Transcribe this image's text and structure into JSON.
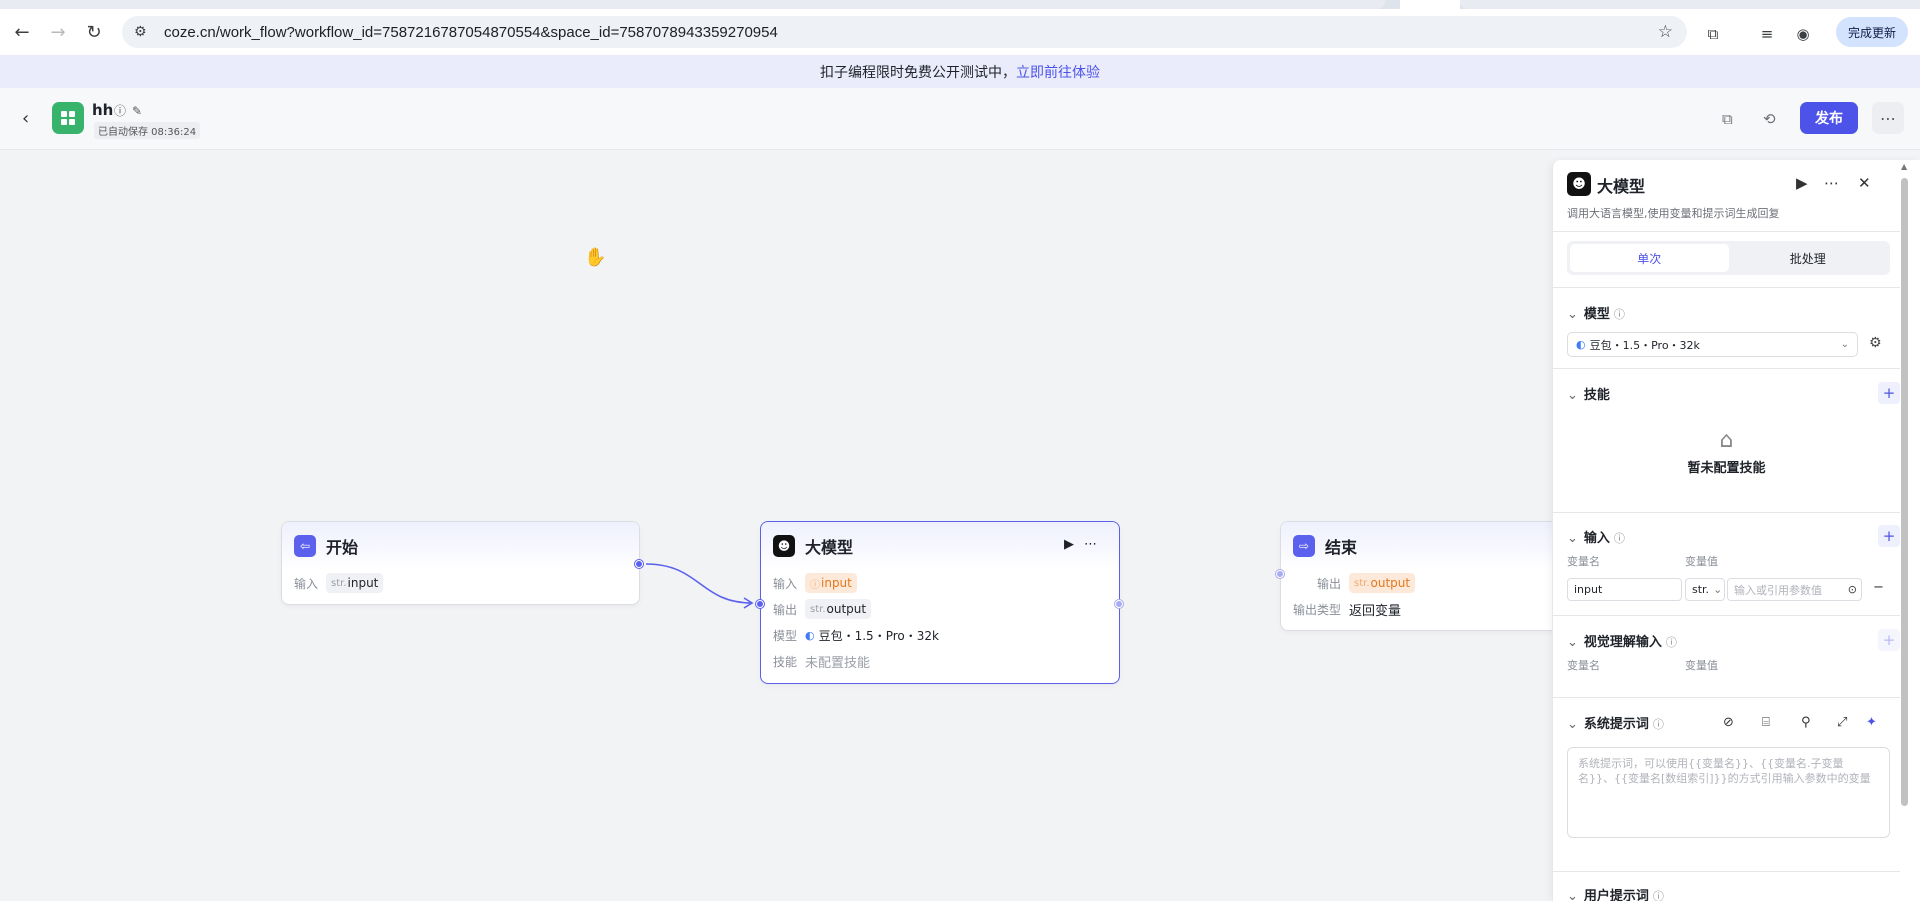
{
  "browser": {
    "url": "coze.cn/work_flow?workflow_id=7587216787054870554&space_id=7587078943359270954",
    "update_label": "完成更新"
  },
  "banner": {
    "text": "扣子编程限时免费公开测试中，",
    "link": "立即前往体验"
  },
  "header": {
    "workflow_name": "hh",
    "autosave": "已自动保存 08:36:24",
    "publish_label": "发布"
  },
  "nodes": {
    "start": {
      "title": "开始",
      "input_label": "输入",
      "input_type": "str.",
      "input_name": "input"
    },
    "llm": {
      "title": "大模型",
      "input_label": "输入",
      "input_name": "input",
      "output_label": "输出",
      "output_type": "str.",
      "output_name": "output",
      "model_label": "模型",
      "model_value": "豆包・1.5・Pro・32k",
      "skill_label": "技能",
      "skill_value": "未配置技能"
    },
    "end": {
      "title": "结束",
      "output_label": "输出",
      "output_type": "str.",
      "output_name": "output",
      "output_type_label": "输出类型",
      "output_type_value": "返回变量"
    }
  },
  "panel": {
    "title": "大模型",
    "description": "调用大语言模型,使用变量和提示词生成回复",
    "tabs": [
      "单次",
      "批处理"
    ],
    "active_tab": "单次",
    "model_section": "模型",
    "model_value": "豆包・1.5・Pro・32k",
    "skill_section": "技能",
    "skill_empty": "暂未配置技能",
    "input_section": "输入",
    "var_name_label": "变量名",
    "var_value_label": "变量值",
    "input_var_name": "input",
    "input_var_type": "str.",
    "input_var_placeholder": "输入或引用参数值",
    "vision_section": "视觉理解输入",
    "system_prompt_section": "系统提示词",
    "system_prompt_placeholder": "系统提示词，可以使用{{变量名}}、{{变量名.子变量名}}、{{变量名[数组索引]}}的方式引用输入参数中的变量",
    "user_prompt_section": "用户提示词"
  },
  "colors": {
    "accent": "#4d53e8",
    "start_green": "#37b36b",
    "warning_orange": "#e5781c"
  }
}
